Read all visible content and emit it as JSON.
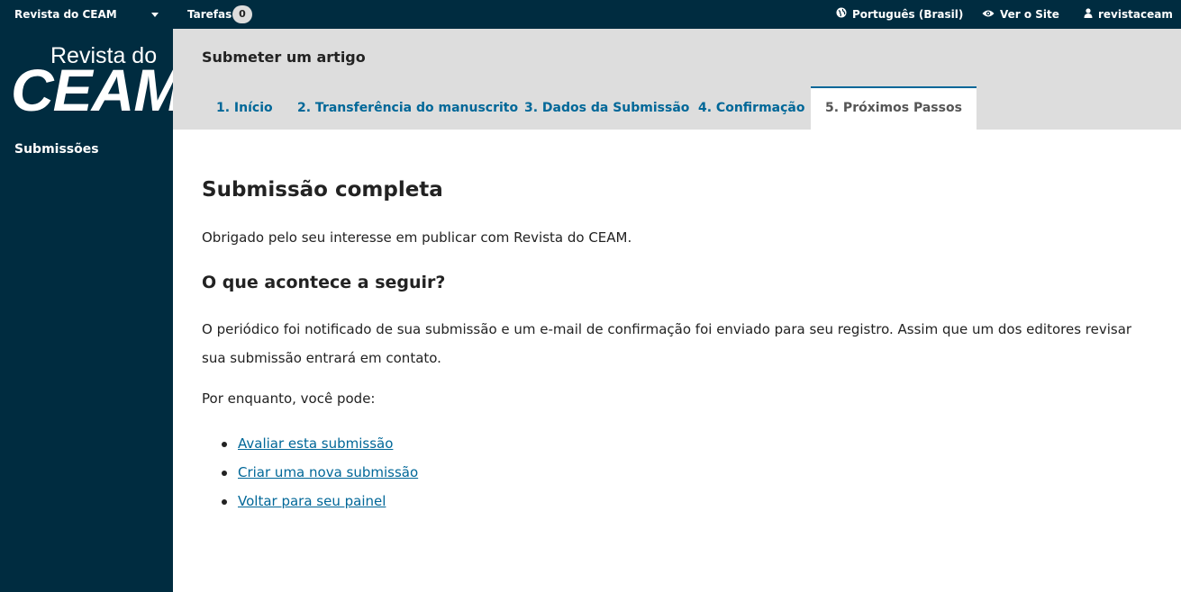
{
  "topbar": {
    "journal_name": "Revista do CEAM",
    "tasks_label": "Tarefas",
    "tasks_count": "0",
    "language": "Português (Brasil)",
    "view_site": "Ver o Site",
    "username": "revistaceam"
  },
  "sidebar": {
    "logo_line1": "Revista do",
    "logo_line2": "CEAM",
    "items": [
      {
        "label": "Submissões"
      }
    ]
  },
  "header": {
    "title": "Submeter um artigo",
    "tabs": [
      {
        "label": "1. Início"
      },
      {
        "label": "2. Transferência do manuscrito"
      },
      {
        "label": "3. Dados da Submissão"
      },
      {
        "label": "4. Confirmação"
      },
      {
        "label": "5. Próximos Passos",
        "active": true
      }
    ]
  },
  "main": {
    "heading": "Submissão completa",
    "thanks": "Obrigado pelo seu interesse em publicar com Revista do CEAM.",
    "subheading": "O que acontece a seguir?",
    "notice": "O periódico foi notificado de sua submissão e um e-mail de confirmação foi enviado para seu registro. Assim que um dos editores revisar sua submissão entrará em contato.",
    "meanwhile": "Por enquanto, você pode:",
    "links": [
      {
        "label": "Avaliar esta submissão"
      },
      {
        "label": "Criar uma nova submissão"
      },
      {
        "label": "Voltar para seu painel"
      }
    ]
  },
  "colors": {
    "navy": "#002c40",
    "link": "#006798",
    "header_bg": "#dddddd"
  }
}
